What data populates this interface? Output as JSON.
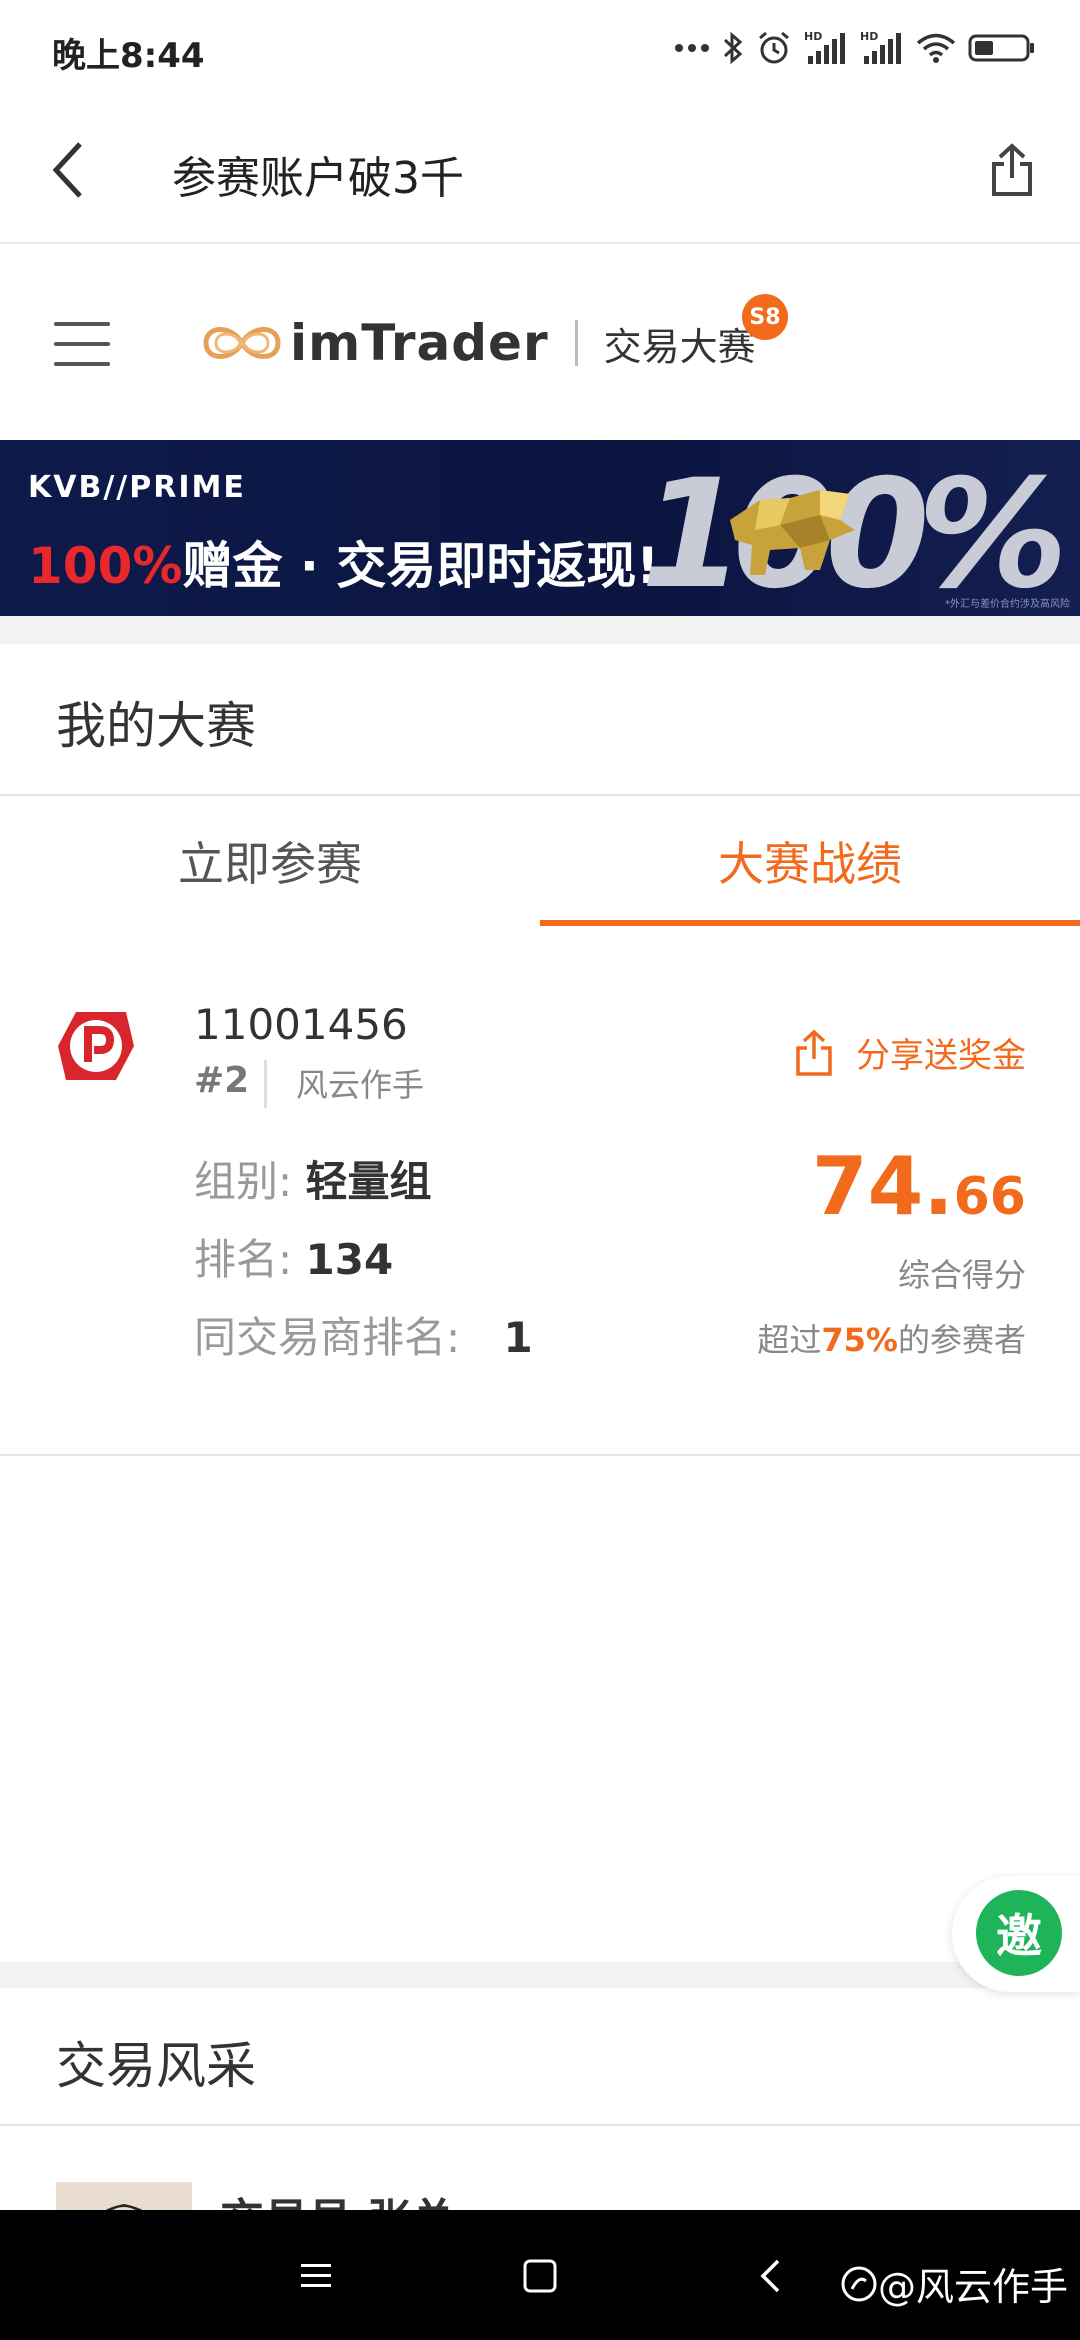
{
  "status_bar": {
    "time": "晚上8:44",
    "icons": [
      "more-dots-icon",
      "bluetooth-icon",
      "alarm-icon",
      "signal-hd-icon",
      "signal-hd-icon",
      "wifi-icon",
      "battery-icon"
    ],
    "hd_label": "HD"
  },
  "nav": {
    "title": "参赛账户破3千",
    "back_icon": "chevron-left-icon",
    "share_icon": "share-icon"
  },
  "brand": {
    "name": "imTrader",
    "subtitle": "交易大赛",
    "badge": "S8",
    "accent": "#f26a1b"
  },
  "banner": {
    "brand": "KVB//PRIME",
    "tagline_highlight": "100%",
    "tagline_rest": "赠金 · 交易即时返现!",
    "big_text": "100%",
    "note": "*外汇与差价合约涉及高风险"
  },
  "my_contest": {
    "title": "我的大赛",
    "tabs": [
      {
        "label": "立即参赛",
        "active": false
      },
      {
        "label": "大赛战绩",
        "active": true
      }
    ]
  },
  "result": {
    "account_id": "11001456",
    "rank_tag": "#2",
    "nickname": "风云作手",
    "share_label": "分享送奖金",
    "group_label": "组别:",
    "group_value": "轻量组",
    "rank_label": "排名:",
    "rank_value": "134",
    "broker_rank_label": "同交易商排名:",
    "broker_rank_value": "1",
    "score_int": "74.",
    "score_dec": "66",
    "score_label": "综合得分",
    "beat_prefix": "超过",
    "beat_percent": "75%",
    "beat_suffix": "的参赛者"
  },
  "invite": {
    "label": "邀",
    "color": "#20b45a"
  },
  "trading_style": {
    "title": "交易风采",
    "trader_name": "交易员 张总"
  },
  "system_nav": {
    "icons": [
      "menu-icon",
      "home-square-icon",
      "back-icon"
    ],
    "watermark": "@风云作手"
  }
}
